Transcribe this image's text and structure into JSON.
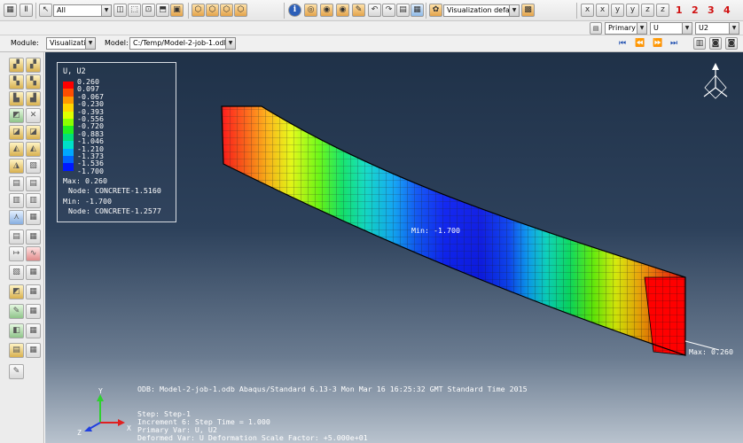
{
  "toolbar": {
    "selection_filter": "All",
    "view_defaults": "Visualization defaults",
    "view_numbers": [
      "1",
      "2",
      "3",
      "4"
    ],
    "field_output": {
      "variable_type": "Primary",
      "variable": "U",
      "component": "U2"
    }
  },
  "context_bar": {
    "module_label": "Module:",
    "module_value": "Visualization",
    "model_label": "Model:",
    "model_value": "C:/Temp/Model-2-job-1.odb"
  },
  "legend": {
    "title": "U, U2",
    "levels": [
      {
        "value": "0.260",
        "color": "#ff0000"
      },
      {
        "value": "0.097",
        "color": "#ff4d00"
      },
      {
        "value": "-0.067",
        "color": "#ff9900"
      },
      {
        "value": "-0.230",
        "color": "#ffd500"
      },
      {
        "value": "-0.393",
        "color": "#dfff00"
      },
      {
        "value": "-0.556",
        "color": "#8cff00"
      },
      {
        "value": "-0.720",
        "color": "#22f020"
      },
      {
        "value": "-0.883",
        "color": "#00e07a"
      },
      {
        "value": "-1.046",
        "color": "#00e0c8"
      },
      {
        "value": "-1.210",
        "color": "#00a8ff"
      },
      {
        "value": "-1.373",
        "color": "#0064ff"
      },
      {
        "value": "-1.536",
        "color": "#0018ff"
      },
      {
        "value": "-1.700",
        "color": "#0000d0"
      }
    ],
    "max_line": "Max: 0.260",
    "max_node": "Node: CONCRETE-1.5160",
    "min_line": "Min: -1.700",
    "min_node": "Node: CONCRETE-1.2577"
  },
  "annotations": {
    "min_label": "Min: -1.700",
    "max_label": "Max: 0.260"
  },
  "footer": {
    "odb_line": "ODB: Model-2-job-1.odb    Abaqus/Standard 6.13-3    Mon Mar 16 16:25:32 GMT Standard Time 2015",
    "step_line": "Step: Step-1",
    "increment_line": "Increment      6: Step Time =    1.000",
    "primary_var_line": "Primary Var: U, U2",
    "deformed_var_line": "Deformed Var: U   Deformation Scale Factor: +5.000e+01"
  },
  "triad": {
    "x": "X",
    "y": "Y",
    "z": "Z"
  },
  "colors": {
    "viewport_top": "#1f3148",
    "viewport_bottom": "#b9c3ce",
    "accent_red": "#d01010"
  },
  "icons": {
    "cursor": "select-arrow-icon",
    "info": "info-icon",
    "camera": "camera-icon",
    "animation": [
      "first-frame-icon",
      "previous-frame-icon",
      "play-icon",
      "last-frame-icon"
    ]
  }
}
